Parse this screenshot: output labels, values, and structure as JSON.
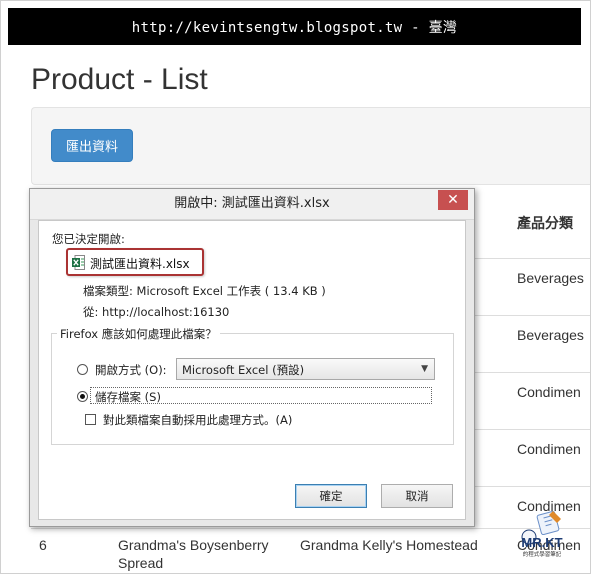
{
  "banner": {
    "text": "http://kevintsengtw.blogspot.tw - 臺灣"
  },
  "page": {
    "title": "Product - List",
    "export_button": "匯出資料"
  },
  "table": {
    "header_category": "產品分類",
    "visible_categories": [
      "Beverages",
      "Beverages",
      "Condimen",
      "Condimen",
      "Condimen"
    ],
    "row6": {
      "id": "6",
      "name_line1": "Grandma's Boysenberry",
      "name_line2": "Spread",
      "supplier": "Grandma Kelly's Homestead",
      "category": "Condimen"
    }
  },
  "dialog": {
    "title": "開啟中: 測試匯出資料.xlsx",
    "close_glyph": "✕",
    "chosen_label": "您已決定開啟:",
    "file_name": "測試匯出資料.xlsx",
    "file_type": "檔案類型:  Microsoft Excel 工作表 ( 13.4 KB )",
    "from": "從:  http://localhost:16130",
    "question": "Firefox 應該如何處理此檔案？",
    "open_with_label": "開啟方式 (O):",
    "open_with_value": "Microsoft Excel (預設)",
    "save_file_label": "儲存檔案 (S)",
    "auto_label": "對此類檔案自動採用此處理方式。(A)",
    "ok_button": "確定",
    "cancel_button": "取消",
    "selected_option": "save"
  },
  "watermark": {
    "text": "MR.KT",
    "subtext": "的程式學習筆記"
  },
  "colors": {
    "banner_bg": "#000000",
    "primary_button": "#428bca",
    "highlight_border": "#aa3333"
  }
}
